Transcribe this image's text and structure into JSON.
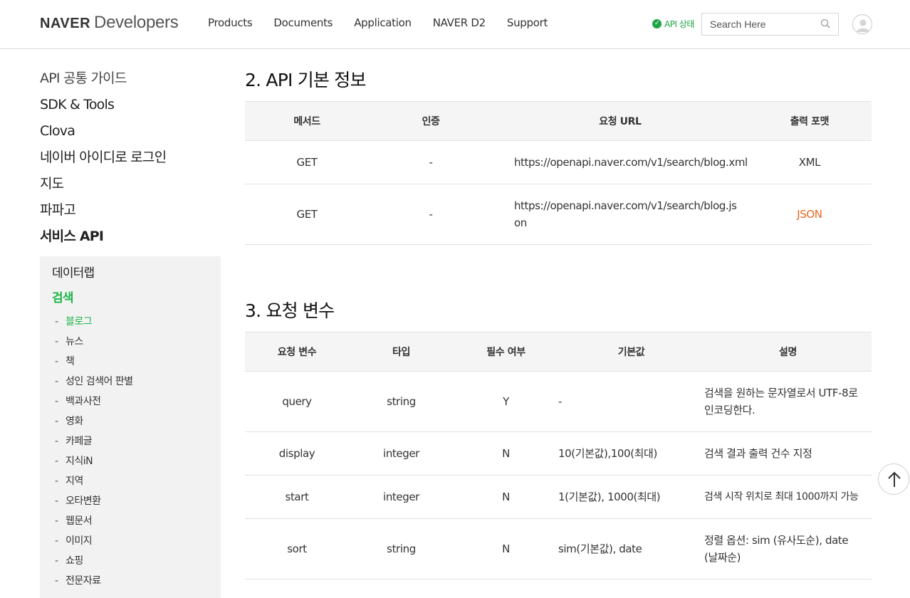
{
  "header": {
    "logo_naver": "NAVER",
    "logo_dev": "Developers",
    "nav": [
      "Products",
      "Documents",
      "Application",
      "NAVER D2",
      "Support"
    ],
    "status_label": "API 상태",
    "search_placeholder": "Search Here",
    "colors": {
      "accent": "#1fa545"
    }
  },
  "sidebar": {
    "top_items": [
      "API 공통 가이드",
      "SDK & Tools",
      "Clova",
      "네이버 아이디로 로그인",
      "지도",
      "파파고",
      "서비스 API"
    ],
    "categories": [
      "데이터랩",
      "검색"
    ],
    "sub_items": [
      "블로그",
      "뉴스",
      "책",
      "성인 검색어 판별",
      "백과사전",
      "영화",
      "카페글",
      "지식iN",
      "지역",
      "오타변환",
      "웹문서",
      "이미지",
      "쇼핑",
      "전문자료"
    ],
    "active_category": "검색",
    "active_sub": "블로그"
  },
  "section2": {
    "title": "2. API 기본 정보",
    "headers": [
      "메서드",
      "인증",
      "요청 URL",
      "출력 포맷"
    ],
    "rows": [
      [
        "GET",
        "-",
        "https://openapi.naver.com/v1/search/blog.xml",
        "XML"
      ],
      [
        "GET",
        "-",
        "https://openapi.naver.com/v1/search/blog.json",
        "JSON"
      ]
    ]
  },
  "section3": {
    "title": "3. 요청 변수",
    "headers": [
      "요청 변수",
      "타입",
      "필수 여부",
      "기본값",
      "설명"
    ],
    "rows": [
      [
        "query",
        "string",
        "Y",
        "-",
        "검색을 원하는 문자열로서 UTF-8로 인코딩한다."
      ],
      [
        "display",
        "integer",
        "N",
        "10(기본값),100(최대)",
        "검색 결과 출력 건수 지정"
      ],
      [
        "start",
        "integer",
        "N",
        "1(기본값), 1000(최대)",
        "검색 시작 위치로 최대 1000까지 가능"
      ],
      [
        "sort",
        "string",
        "N",
        "sim(기본값), date",
        "정렬 옵션: sim (유사도순), date (날짜순)"
      ]
    ]
  }
}
